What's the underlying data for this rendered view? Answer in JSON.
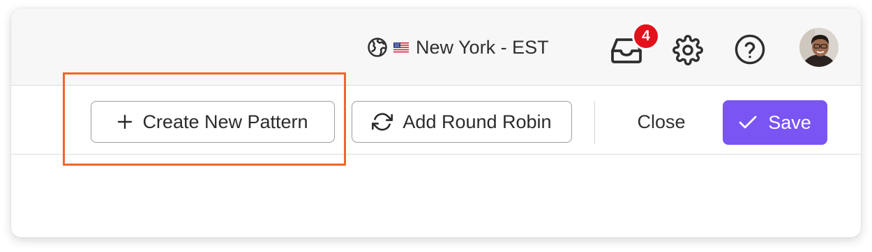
{
  "header": {
    "timezone_flag": "🇺🇸",
    "timezone_label": "New York - EST",
    "inbox_badge_count": "4",
    "icons": [
      "globe-icon",
      "us-flag-icon",
      "inbox-icon",
      "gear-icon",
      "help-icon",
      "avatar"
    ]
  },
  "toolbar": {
    "create_pattern_label": "Create New Pattern",
    "add_round_robin_label": "Add Round Robin",
    "close_label": "Close",
    "save_label": "Save",
    "icons": [
      "plus-icon",
      "refresh-icon",
      "check-icon"
    ]
  },
  "colors": {
    "accent": "#7a55f4",
    "badge": "#e3111c",
    "highlight": "#f26528",
    "topbar_bg": "#f7f7f7"
  }
}
